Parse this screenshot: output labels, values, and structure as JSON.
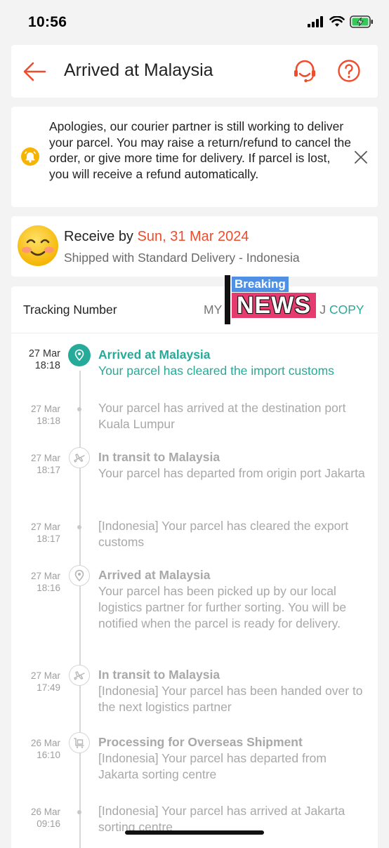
{
  "status_bar": {
    "time": "10:56"
  },
  "header": {
    "title": "Arrived at Malaysia"
  },
  "notice": {
    "text": "Apologies, our courier partner is still working to deliver your parcel. You may raise a return/refund to cancel the order, or give more time for delivery. If parcel is lost, you will receive a refund automatically."
  },
  "delivery": {
    "receive_label": "Receive by",
    "receive_date": "Sun, 31 Mar 2024",
    "shipped_text": "Shipped with Standard Delivery - Indonesia"
  },
  "tracking": {
    "label": "Tracking Number",
    "value_prefix": "MY",
    "value_suffix": "J",
    "copy_label": "COPY"
  },
  "overlay": {
    "breaking": "Breaking",
    "news": "NEWS"
  },
  "events": [
    {
      "date": "27 Mar",
      "time": "18:18",
      "title": "Arrived at Malaysia",
      "desc": "Your parcel has cleared the import customs",
      "icon": "location-pin-icon"
    },
    {
      "date": "27 Mar",
      "time": "18:18",
      "title": "",
      "desc": "Your parcel has arrived at the destination port Kuala Lumpur",
      "icon": "dot"
    },
    {
      "date": "27 Mar",
      "time": "18:17",
      "title": "In transit to Malaysia",
      "desc": "Your parcel has departed from origin port Jakarta",
      "icon": "airplane-icon"
    },
    {
      "date": "27 Mar",
      "time": "18:17",
      "title": "",
      "desc": "[Indonesia] Your parcel has cleared the export customs",
      "icon": "dot"
    },
    {
      "date": "27 Mar",
      "time": "18:16",
      "title": "Arrived at Malaysia",
      "desc": "Your parcel has been picked up by our local logistics partner for further sorting. You will be notified when the parcel is ready for delivery.",
      "icon": "location-pin-icon"
    },
    {
      "date": "27 Mar",
      "time": "17:49",
      "title": "In transit to Malaysia",
      "desc": "[Indonesia] Your parcel has been handed over to the next logistics partner",
      "icon": "airplane-icon"
    },
    {
      "date": "26 Mar",
      "time": "16:10",
      "title": "Processing for Overseas Shipment",
      "desc": "[Indonesia] Your parcel has departed from Jakarta sorting centre",
      "icon": "cart-icon"
    },
    {
      "date": "26 Mar",
      "time": "09:16",
      "title": "",
      "desc": "[Indonesia] Your parcel has arrived at Jakarta sorting centre",
      "icon": "dot"
    }
  ],
  "colors": {
    "brand": "#ee4d2d",
    "teal": "#26aa99",
    "warning": "#f6b400"
  }
}
